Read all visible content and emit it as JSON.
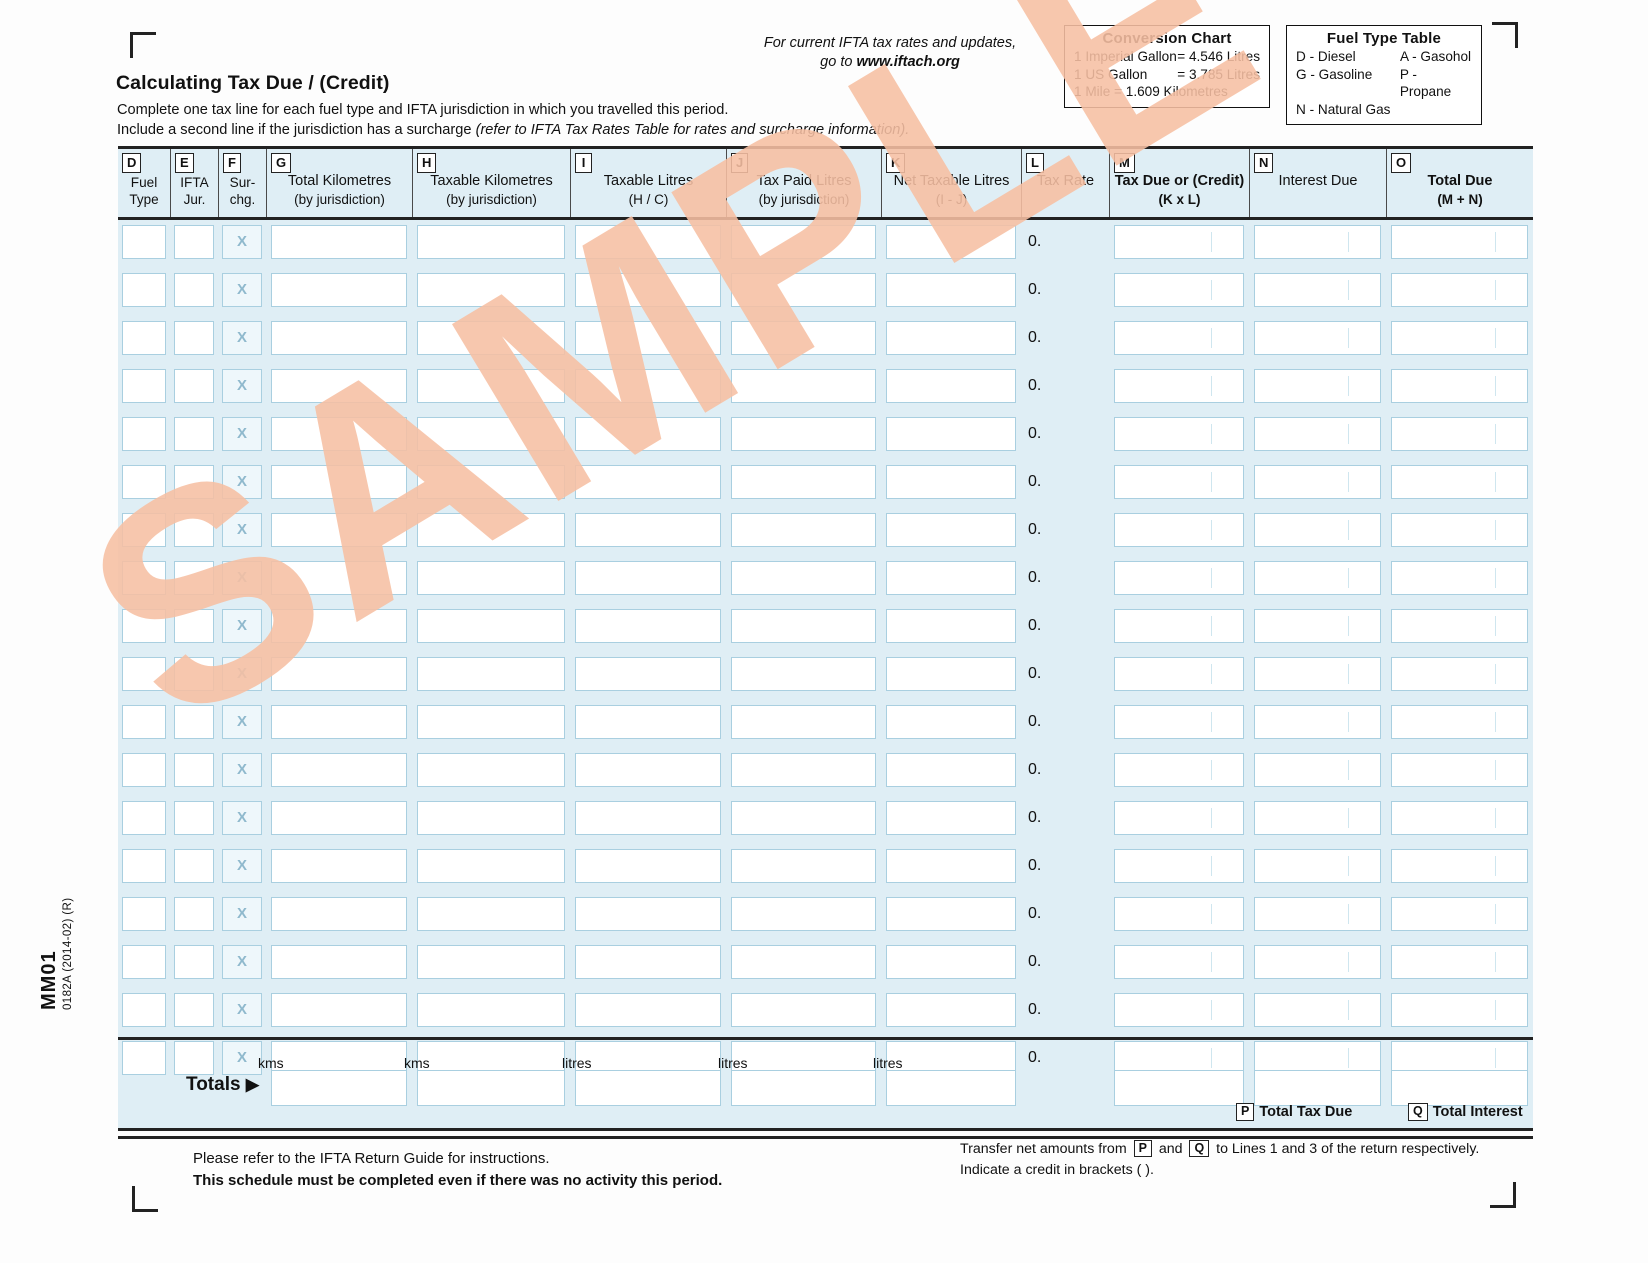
{
  "header": {
    "iftach_line1": "For current IFTA tax rates and updates,",
    "iftach_line2_prefix": "go to ",
    "iftach_url": "www.iftach.org",
    "title": "Calculating Tax Due / (Credit)",
    "instruction_line1": "Complete one tax line for each fuel type and  IFTA jurisdiction in which you travelled this period.",
    "instruction_line2_plain": "Include a second line if the jurisdiction has a surcharge ",
    "instruction_line2_italic": "(refer to IFTA Tax Rates Table for rates and surcharge information)."
  },
  "conversion_chart": {
    "title": "Conversion Chart",
    "rows": [
      {
        "key": "1 Imperial Gallon",
        "value": "= 4.546 Litres"
      },
      {
        "key": "1 US Gallon",
        "value": "= 3.785 Litres"
      },
      {
        "key": "1 Mile = 1.609 Kilometres",
        "value": ""
      }
    ]
  },
  "fuel_type_table": {
    "title": "Fuel Type Table",
    "rows": [
      {
        "left": "D - Diesel",
        "right": "A - Gasohol"
      },
      {
        "left": "G - Gasoline",
        "right": "P - Propane"
      },
      {
        "left": "N - Natural Gas",
        "right": ""
      }
    ]
  },
  "columns": [
    {
      "tag": "D",
      "line1": "Fuel",
      "line2": "Type",
      "bold": false
    },
    {
      "tag": "E",
      "line1": "IFTA",
      "line2": "Jur.",
      "bold": false
    },
    {
      "tag": "F",
      "line1": "Sur-",
      "line2": "chg.",
      "bold": false
    },
    {
      "tag": "G",
      "line1": "Total Kilometres",
      "line2": "(by jurisdiction)",
      "bold": false
    },
    {
      "tag": "H",
      "line1": "Taxable Kilometres",
      "line2": "(by jurisdiction)",
      "bold": false
    },
    {
      "tag": "I",
      "line1": "Taxable Litres",
      "line2": "(H  / C)",
      "bold": false
    },
    {
      "tag": "J",
      "line1": "Tax Paid Litres",
      "line2": "(by jurisdiction)",
      "bold": false
    },
    {
      "tag": "K",
      "line1": "Net Taxable Litres",
      "line2": "(I - J)",
      "bold": false
    },
    {
      "tag": "L",
      "line1": "Tax Rate",
      "line2": "",
      "bold": false
    },
    {
      "tag": "M",
      "line1": "Tax Due or (Credit)",
      "line2": "(K x L)",
      "bold": true
    },
    {
      "tag": "N",
      "line1": "Interest Due",
      "line2": "",
      "bold": false
    },
    {
      "tag": "O",
      "line1": "Total Due",
      "line2": "(M + N)",
      "bold": true
    }
  ],
  "rows": {
    "count": 18,
    "surcharge_mark": "X",
    "tax_rate_prefix": "0."
  },
  "totals": {
    "label": "Totals",
    "arrow": "▶",
    "units": [
      {
        "text": "kms"
      },
      {
        "text": "kms"
      },
      {
        "text": "litres"
      },
      {
        "text": "litres"
      },
      {
        "text": "litres"
      }
    ],
    "dollar_sign": "$",
    "p_tag": "P",
    "p_label": "Total Tax Due",
    "q_tag": "Q",
    "q_label": "Total Interest"
  },
  "footer": {
    "left_line1": "Please refer to the IFTA Return Guide for instructions.",
    "left_line2": "This schedule must be completed even if there was no activity this period.",
    "right_line1_a": "Transfer net amounts from ",
    "right_tag_p": "P",
    "right_line1_b": " and ",
    "right_tag_q": "Q",
    "right_line1_c": " to Lines 1 and 3 of the return respectively.",
    "right_line2": "Indicate a credit in brackets ( )."
  },
  "side": {
    "form_code": "MM01",
    "form_rev": "0182A (2014-02) (R)"
  },
  "watermark": {
    "text": "SAMPLE",
    "color": "#f7c0a3"
  }
}
